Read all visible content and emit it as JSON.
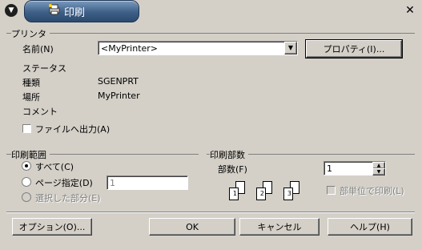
{
  "window": {
    "title": "印刷",
    "menu_icon": "chevron-down-icon",
    "close_glyph": "✕"
  },
  "printer": {
    "group_label": "プリンタ",
    "name_label": "名前(N)",
    "name_value": "<MyPrinter>",
    "properties_button": "プロパティ(I)...",
    "status_label": "ステータス",
    "type_label": "種類",
    "type_value": "SGENPRT",
    "location_label": "場所",
    "location_value": "MyPrinter",
    "comment_label": "コメント",
    "print_to_file_label": "ファイルへ出力(A)"
  },
  "range": {
    "group_label": "印刷範囲",
    "all_label": "すべて(C)",
    "pages_label": "ページ指定(D)",
    "pages_value": "1",
    "selection_label": "選択した部分(E)"
  },
  "copies": {
    "group_label": "印刷部数",
    "count_label": "部数(F)",
    "count_value": "1",
    "collate_label": "部単位で印刷(L)",
    "page_numbers": [
      "1",
      "2",
      "3"
    ]
  },
  "buttons": {
    "options": "オプション(O)...",
    "ok": "OK",
    "cancel": "キャンセル",
    "help": "ヘルプ(H)"
  }
}
